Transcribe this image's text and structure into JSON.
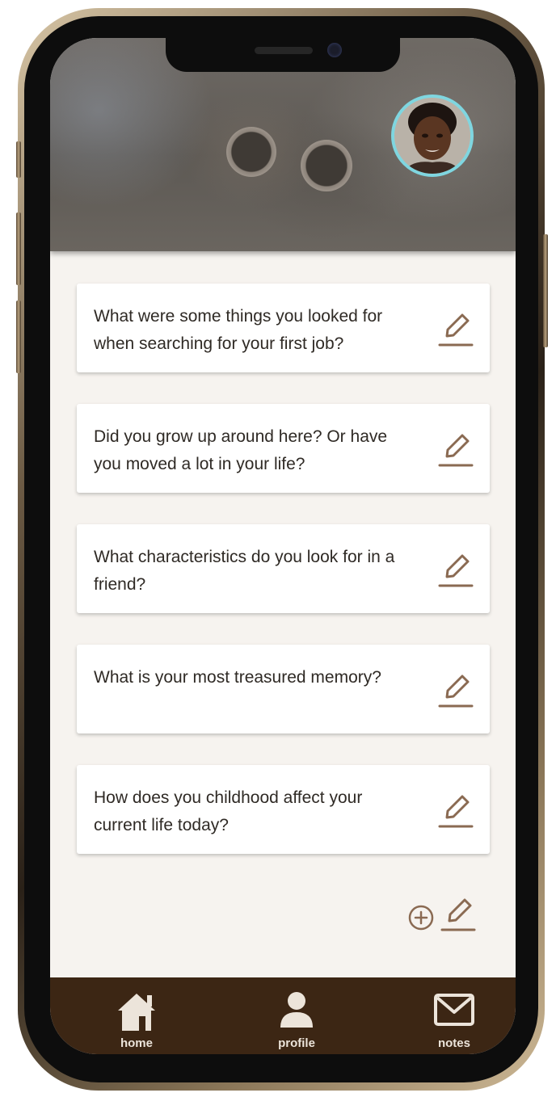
{
  "questions": [
    {
      "text": "What were some things you looked for when searching for your first job?"
    },
    {
      "text": "Did you grow up around here? Or have you moved a lot in your life?"
    },
    {
      "text": "What characteristics do you look for in a friend?"
    },
    {
      "text": "What is your most treasured memory?"
    },
    {
      "text": "How does you childhood affect your current life today?"
    }
  ],
  "nav": {
    "home": "home",
    "profile": "profile",
    "notes": "notes"
  },
  "icons": {
    "edit": "pencil-edit-icon",
    "add": "plus-circle-icon",
    "home": "house-icon",
    "profile": "person-icon",
    "notes": "envelope-icon"
  },
  "colors": {
    "accent_brown": "#8a6a52",
    "navbar_bg": "#3c2614",
    "screen_bg": "#f6f3ef",
    "avatar_ring": "#7fd6e0",
    "nav_icon": "#ece4da"
  }
}
